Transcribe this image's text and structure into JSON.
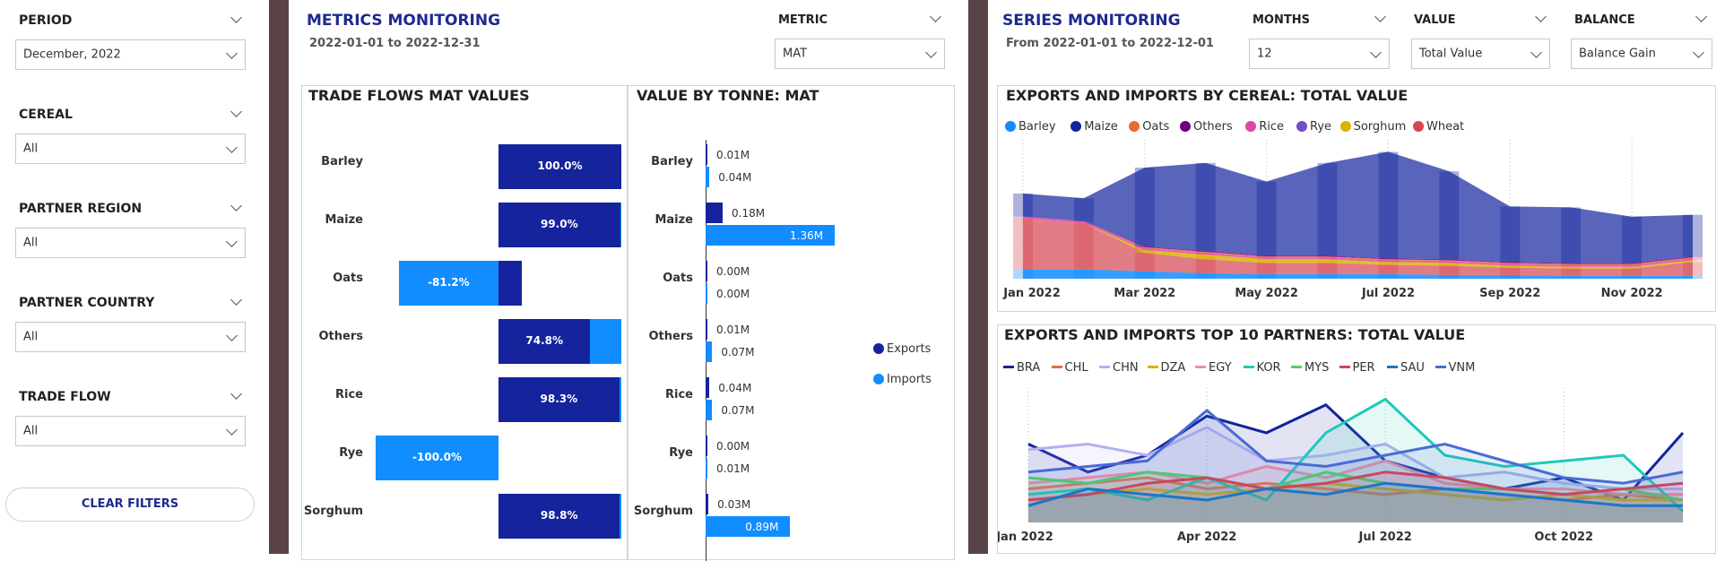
{
  "filters": {
    "period": {
      "label": "PERIOD",
      "value": "December, 2022"
    },
    "cereal": {
      "label": "CEREAL",
      "value": "All"
    },
    "partner_region": {
      "label": "PARTNER REGION",
      "value": "All"
    },
    "partner_country": {
      "label": "PARTNER COUNTRY",
      "value": "All"
    },
    "trade_flow": {
      "label": "TRADE FLOW",
      "value": "All"
    },
    "clear_label": "CLEAR FILTERS"
  },
  "metrics": {
    "title": "METRICS MONITORING",
    "date_range": "2022-01-01 to 2022-12-31",
    "metric_label": "METRIC",
    "metric_value": "MAT",
    "left_chart_title": "TRADE FLOWS MAT VALUES",
    "right_chart_title": "VALUE BY TONNE: MAT"
  },
  "series": {
    "title": "SERIES MONITORING",
    "date_range": "From 2022-01-01 to 2022-12-01",
    "months_label": "MONTHS",
    "months_value": "12",
    "value_label": "VALUE",
    "value_value": "Total Value",
    "balance_label": "BALANCE",
    "balance_value": "Balance Gain",
    "top_chart_title": "EXPORTS AND IMPORTS BY CEREAL: TOTAL VALUE",
    "bottom_chart_title": "EXPORTS AND IMPORTS TOP 10 PARTNERS: TOTAL VALUE"
  },
  "colors": {
    "exports": "#15239c",
    "imports": "#118dff"
  },
  "chart_data": [
    {
      "type": "bar",
      "title": "TRADE FLOWS MAT VALUES",
      "categories": [
        "Barley",
        "Maize",
        "Oats",
        "Others",
        "Rice",
        "Rye",
        "Sorghum"
      ],
      "series": [
        {
          "name": "Exports",
          "values": [
            100.0,
            99.0,
            18.8,
            74.8,
            98.3,
            0,
            98.8
          ]
        },
        {
          "name": "Imports",
          "values": [
            0,
            1.0,
            -81.2,
            25.2,
            1.7,
            -100.0,
            1.2
          ]
        }
      ],
      "data_labels": [
        "100.0%",
        "99.0%",
        "-81.2%",
        "74.8%",
        "98.3%",
        "-100.0%",
        "98.8%"
      ]
    },
    {
      "type": "bar",
      "title": "VALUE BY TONNE: MAT",
      "categories": [
        "Barley",
        "Maize",
        "Oats",
        "Others",
        "Rice",
        "Rye",
        "Sorghum"
      ],
      "series": [
        {
          "name": "Exports",
          "values": [
            0.01,
            0.18,
            0.0,
            0.01,
            0.04,
            0.0,
            0.03
          ],
          "labels": [
            "0.01M",
            "0.18M",
            "0.00M",
            "0.01M",
            "0.04M",
            "0.00M",
            "0.03M"
          ]
        },
        {
          "name": "Imports",
          "values": [
            0.04,
            1.36,
            0.0,
            0.07,
            0.07,
            0.01,
            0.89
          ],
          "labels": [
            "0.04M",
            "1.36M",
            "0.00M",
            "0.07M",
            "0.07M",
            "0.01M",
            "0.89M"
          ]
        }
      ],
      "legend": [
        "Exports",
        "Imports"
      ]
    },
    {
      "type": "area",
      "title": "EXPORTS AND IMPORTS BY CEREAL: TOTAL VALUE",
      "x": [
        "Jan 2022",
        "Feb 2022",
        "Mar 2022",
        "Apr 2022",
        "May 2022",
        "Jun 2022",
        "Jul 2022",
        "Aug 2022",
        "Sep 2022",
        "Oct 2022",
        "Nov 2022",
        "Dec 2022"
      ],
      "x_ticks": [
        "Jan 2022",
        "Mar 2022",
        "May 2022",
        "Jul 2022",
        "Sep 2022",
        "Nov 2022"
      ],
      "series": [
        {
          "name": "Barley",
          "color": "#118dff",
          "values": [
            10,
            10,
            8,
            6,
            5,
            5,
            5,
            4,
            4,
            3,
            3,
            3
          ]
        },
        {
          "name": "Maize",
          "color": "#12239e",
          "values": [
            25,
            25,
            85,
            95,
            80,
            100,
            115,
            95,
            60,
            60,
            50,
            45
          ]
        },
        {
          "name": "Oats",
          "color": "#e66c37",
          "values": [
            0,
            0,
            1,
            1,
            1,
            1,
            1,
            1,
            1,
            1,
            1,
            1
          ]
        },
        {
          "name": "Others",
          "color": "#6b007b",
          "values": [
            0,
            0,
            1,
            1,
            1,
            1,
            1,
            1,
            1,
            1,
            1,
            1
          ]
        },
        {
          "name": "Rice",
          "color": "#e044a7",
          "values": [
            2,
            2,
            2,
            2,
            2,
            2,
            2,
            2,
            2,
            2,
            2,
            2
          ]
        },
        {
          "name": "Rye",
          "color": "#744ec2",
          "values": [
            0,
            0,
            0,
            0,
            0,
            0,
            0,
            0,
            0,
            0,
            0,
            0
          ]
        },
        {
          "name": "Sorghum",
          "color": "#d9b300",
          "values": [
            0,
            0,
            3,
            5,
            4,
            4,
            3,
            3,
            2,
            2,
            2,
            2
          ]
        },
        {
          "name": "Wheat",
          "color": "#d64550",
          "values": [
            55,
            50,
            20,
            15,
            12,
            12,
            10,
            10,
            8,
            8,
            8,
            15
          ]
        }
      ]
    },
    {
      "type": "line",
      "title": "EXPORTS AND IMPORTS TOP 10 PARTNERS: TOTAL VALUE",
      "x": [
        "Jan 2022",
        "Feb 2022",
        "Mar 2022",
        "Apr 2022",
        "May 2022",
        "Jun 2022",
        "Jul 2022",
        "Aug 2022",
        "Sep 2022",
        "Oct 2022",
        "Nov 2022",
        "Dec 2022"
      ],
      "x_ticks": [
        "Jan 2022",
        "Apr 2022",
        "Jul 2022",
        "Oct 2022"
      ],
      "series": [
        {
          "name": "BRA",
          "color": "#12239e",
          "values": [
            70,
            45,
            60,
            95,
            80,
            105,
            55,
            40,
            30,
            40,
            20,
            80
          ]
        },
        {
          "name": "CHL",
          "color": "#e66c37",
          "values": [
            30,
            35,
            40,
            30,
            35,
            30,
            25,
            30,
            25,
            20,
            25,
            20
          ]
        },
        {
          "name": "CHN",
          "color": "#b3b0f0",
          "values": [
            65,
            70,
            60,
            85,
            55,
            60,
            70,
            40,
            45,
            35,
            30,
            30
          ]
        },
        {
          "name": "DZA",
          "color": "#d9b300",
          "values": [
            20,
            25,
            30,
            25,
            30,
            35,
            30,
            25,
            20,
            25,
            20,
            20
          ]
        },
        {
          "name": "EGY",
          "color": "#f48ca4",
          "values": [
            35,
            40,
            45,
            35,
            50,
            40,
            55,
            35,
            30,
            30,
            25,
            25
          ]
        },
        {
          "name": "KOR",
          "color": "#20c9b8",
          "values": [
            25,
            30,
            20,
            40,
            20,
            80,
            110,
            60,
            50,
            55,
            60,
            10
          ]
        },
        {
          "name": "MYS",
          "color": "#4fd36b",
          "values": [
            40,
            35,
            45,
            40,
            30,
            45,
            35,
            30,
            30,
            25,
            30,
            20
          ]
        },
        {
          "name": "PER",
          "color": "#d64550",
          "values": [
            20,
            25,
            35,
            40,
            30,
            35,
            45,
            40,
            30,
            25,
            30,
            35
          ]
        },
        {
          "name": "SAU",
          "color": "#1478c8",
          "values": [
            15,
            30,
            25,
            20,
            30,
            25,
            35,
            30,
            25,
            20,
            15,
            15
          ]
        },
        {
          "name": "VNM",
          "color": "#4a6bd6",
          "values": [
            45,
            50,
            55,
            100,
            55,
            50,
            60,
            70,
            55,
            40,
            35,
            45
          ]
        }
      ]
    }
  ]
}
